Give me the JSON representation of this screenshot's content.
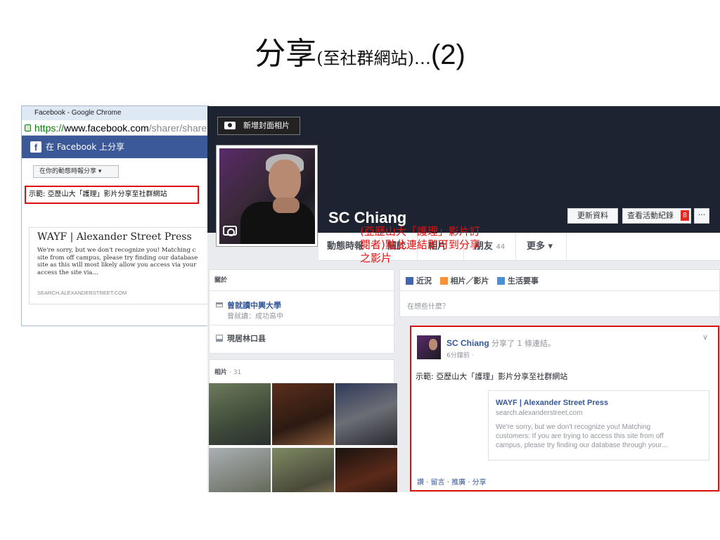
{
  "slide": {
    "title_big": "分享",
    "title_small": "(至社群網站)…",
    "title_num": "(2)"
  },
  "share_dialog": {
    "window_title": "Facebook - Google Chrome",
    "url_scheme": "https://",
    "url_host": "www.facebook.com",
    "url_path": "/sharer/sharer.",
    "header": "在 Facebook 上分享",
    "share_target": "在你的動態時報分享 ▾",
    "message": "示範: 亞歷山大「護理」影片分享至社群網站",
    "card": {
      "title": "WAYF | Alexander Street Press",
      "desc": "We're sorry, but we don't recognize you! Matching c\nsite from off campus, please try finding our database\nsite as this will most likely allow you access via your\naccess the site via...",
      "url": "SEARCH.ALEXANDERSTREET.COM"
    }
  },
  "profile": {
    "cover_button": "新增封面相片",
    "name": "SC Chiang",
    "update_info": "更新資料",
    "activity_log": "查看活動紀錄",
    "activity_badge": "8",
    "more_btn": "···",
    "tabs": [
      {
        "label": "動態時報",
        "count": ""
      },
      {
        "label": "關於",
        "count": ""
      },
      {
        "label": "相片",
        "count": ""
      },
      {
        "label": "朋友",
        "count": "44"
      },
      {
        "label": "更多 ▾",
        "count": ""
      }
    ]
  },
  "about": {
    "heading": "關於",
    "education": "曾就讀中興大學",
    "education_sub": "曾就讀：成功高中",
    "residence": "現居林口县"
  },
  "photos": {
    "heading": "相片",
    "count": "· 31"
  },
  "composer": {
    "status": "近況",
    "photo_video": "相片／影片",
    "life_event": "生活要事",
    "placeholder": "在想些什麼？"
  },
  "post": {
    "author": "SC Chiang",
    "action": "分享了 1 條連結。",
    "time": "6分鐘前 ·",
    "message": "示範: 亞歷山大「護理」影片分享至社群網站",
    "link": {
      "title": "WAYF | Alexander Street Press",
      "url": "search.alexanderstreet.com",
      "desc": "We're sorry, but we don't recognize you! Matching\ncustomers: If you are trying to access this site from off\ncampus, please try finding our database through your..."
    },
    "actions": "讚 · 留言 · 推廣 · 分享",
    "chevron": "∨"
  },
  "annotation": "(亞歷山大「護理」影片訂\n閱者)點此連結即可到分享\n之影片",
  "colors": {
    "facebook_blue": "#3b5998",
    "highlight_red": "#e01010",
    "link_blue": "#365899"
  }
}
